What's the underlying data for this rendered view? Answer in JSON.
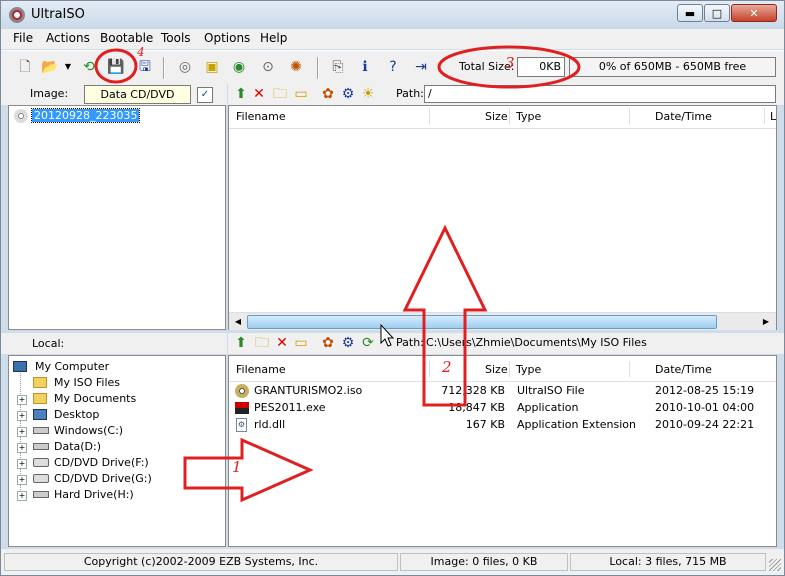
{
  "window": {
    "title": "UltraISO",
    "minimize": "▬",
    "maximize": "□",
    "close": "✕"
  },
  "menu": [
    "File",
    "Actions",
    "Bootable",
    "Tools",
    "Options",
    "Help"
  ],
  "toolbar": {
    "total_size_label": "Total Size:",
    "total_size_value": "0KB",
    "capacity": "0% of 650MB - 650MB free"
  },
  "image_bar": {
    "label": "Image:",
    "type_value": "Data CD/DVD",
    "path_label": "Path:",
    "path_value": "/"
  },
  "iso_tree": {
    "root": "20120928_223035"
  },
  "columns": {
    "filename": "Filename",
    "size": "Size",
    "type": "Type",
    "datetime": "Date/Time",
    "extra": "L"
  },
  "local": {
    "label": "Local:",
    "path_label": "Path:",
    "path_value": "C:\\Users\\Zhmie\\Documents\\My ISO Files",
    "tree": [
      {
        "label": "My Computer"
      },
      {
        "label": "My ISO Files"
      },
      {
        "label": "My Documents"
      },
      {
        "label": "Desktop"
      },
      {
        "label": "Windows(C:)"
      },
      {
        "label": "Data(D:)"
      },
      {
        "label": "CD/DVD Drive(F:)"
      },
      {
        "label": "CD/DVD Drive(G:)"
      },
      {
        "label": "Hard Drive(H:)"
      }
    ],
    "files": [
      {
        "name": "GRANTURISMO2.iso",
        "size": "712,328 KB",
        "type": "UltraISO File",
        "date": "2012-08-25 15:19"
      },
      {
        "name": "PES2011.exe",
        "size": "18,847 KB",
        "type": "Application",
        "date": "2010-10-01 04:00"
      },
      {
        "name": "rld.dll",
        "size": "167 KB",
        "type": "Application Extension",
        "date": "2010-09-24 22:21"
      }
    ]
  },
  "status": {
    "copyright": "Copyright (c)2002-2009 EZB Systems, Inc.",
    "image": "Image: 0 files, 0 KB",
    "local": "Local: 3 files, 715 MB"
  },
  "annotations": {
    "n1": "1",
    "n2": "2",
    "n3": "3",
    "n4": "4"
  },
  "colors": {
    "annotation": "#e02020",
    "selection": "#3399ff",
    "progress_bg": "#f4f4f4"
  }
}
